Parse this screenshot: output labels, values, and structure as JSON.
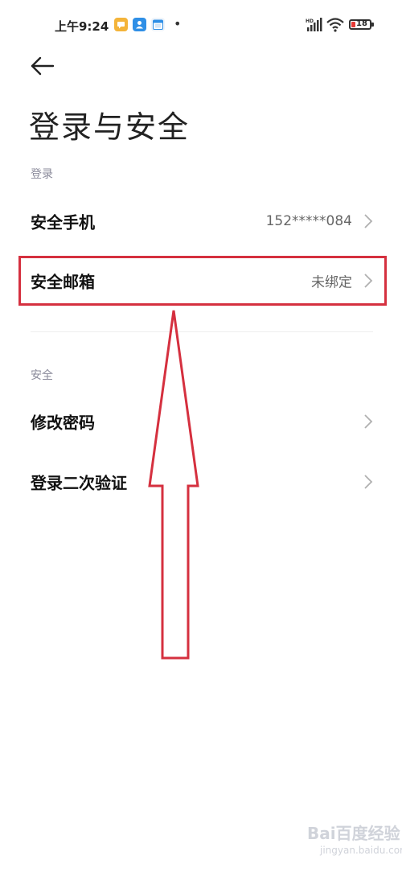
{
  "status_bar": {
    "time": "上午9:24",
    "battery": "18",
    "icons": [
      "messages-app-icon",
      "contacts-app-icon",
      "calendar-app-icon",
      "notification-dot",
      "hd-signal-icon",
      "wifi-icon",
      "battery-icon"
    ]
  },
  "header": {
    "back_icon": "back-arrow-icon",
    "title": "登录与安全"
  },
  "login_section": {
    "header": "登录",
    "items": [
      {
        "label": "安全手机",
        "value": "152*****084"
      },
      {
        "label": "安全邮箱",
        "value": "未绑定"
      }
    ]
  },
  "security_section": {
    "header": "安全",
    "items": [
      {
        "label": "修改密码",
        "value": ""
      },
      {
        "label": "登录二次验证",
        "value": ""
      }
    ]
  },
  "annotation": {
    "color": "#d5303f"
  },
  "watermark": {
    "text": "Bai百度经验",
    "sub": "jingyan.baidu.com"
  },
  "colors": {
    "accent_red": "#d5303f",
    "battery_low": "#e53935",
    "section_header": "#8a8a9a"
  }
}
